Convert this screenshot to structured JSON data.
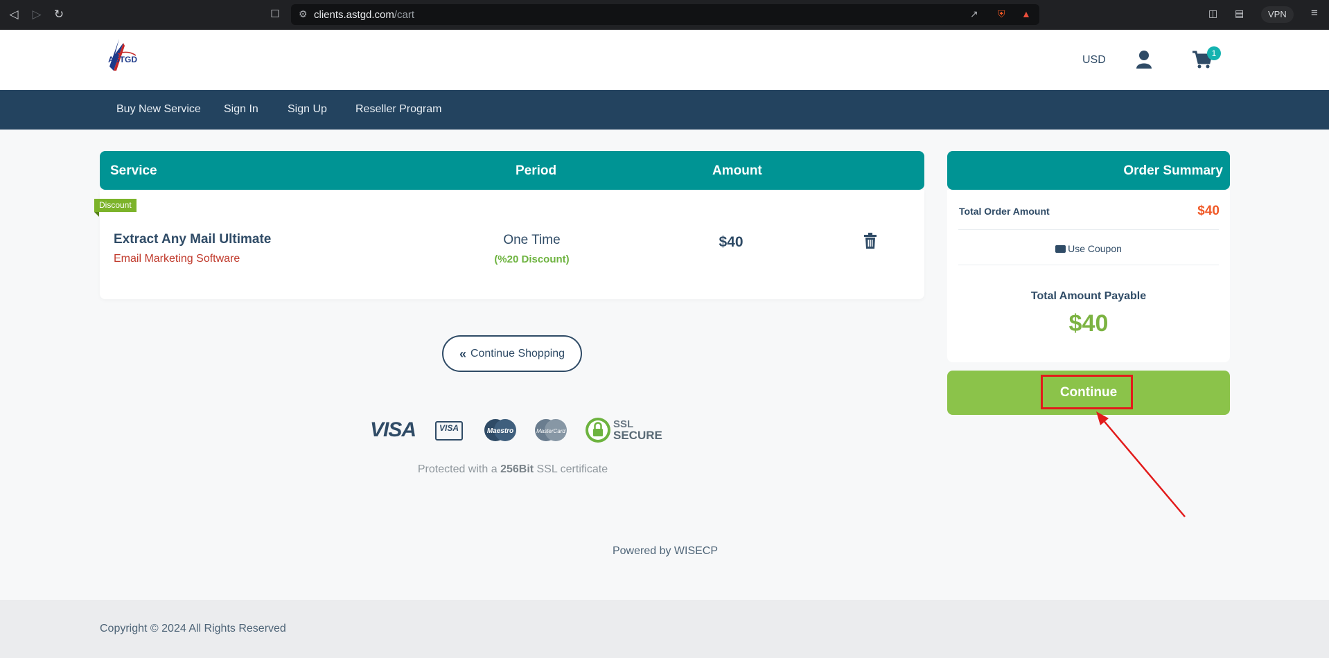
{
  "browser": {
    "url_domain": "clients.astgd.com",
    "url_path": "/cart",
    "vpn_label": "VPN"
  },
  "header": {
    "logo_text": "ASTGD",
    "currency": "USD",
    "cart_count": "1"
  },
  "nav": {
    "items": [
      {
        "label": "Buy New Service"
      },
      {
        "label": "Sign In"
      },
      {
        "label": "Sign Up"
      },
      {
        "label": "Reseller Program"
      }
    ]
  },
  "cart": {
    "columns": {
      "service": "Service",
      "period": "Period",
      "amount": "Amount"
    },
    "items": [
      {
        "tag": "Discount",
        "name": "Extract Any Mail Ultimate",
        "category": "Email Marketing Software",
        "period": "One Time",
        "period_discount": "(%20 Discount)",
        "amount": "$40"
      }
    ],
    "continue_shopping": "Continue Shopping",
    "ssl_prefix": "Protected with a",
    "ssl_bits": "256Bit",
    "ssl_suffix": "SSL certificate",
    "payment_logos": [
      "VISA",
      "VISA Electron",
      "Maestro",
      "MasterCard",
      "SSL SECURE"
    ]
  },
  "summary": {
    "title": "Order Summary",
    "total_label": "Total Order Amount",
    "total_value": "$40",
    "coupon_label": "Use Coupon",
    "payable_label": "Total Amount Payable",
    "payable_value": "$40",
    "continue_label": "Continue"
  },
  "powered_by": "Powered by WISECP",
  "footer": {
    "copyright": "Copyright © 2024 All Rights Reserved"
  },
  "colors": {
    "teal": "#009494",
    "nav_bg": "#23435f",
    "green": "#8bc34a",
    "orange": "#f05a28",
    "annotation_red": "#e21b1b"
  }
}
